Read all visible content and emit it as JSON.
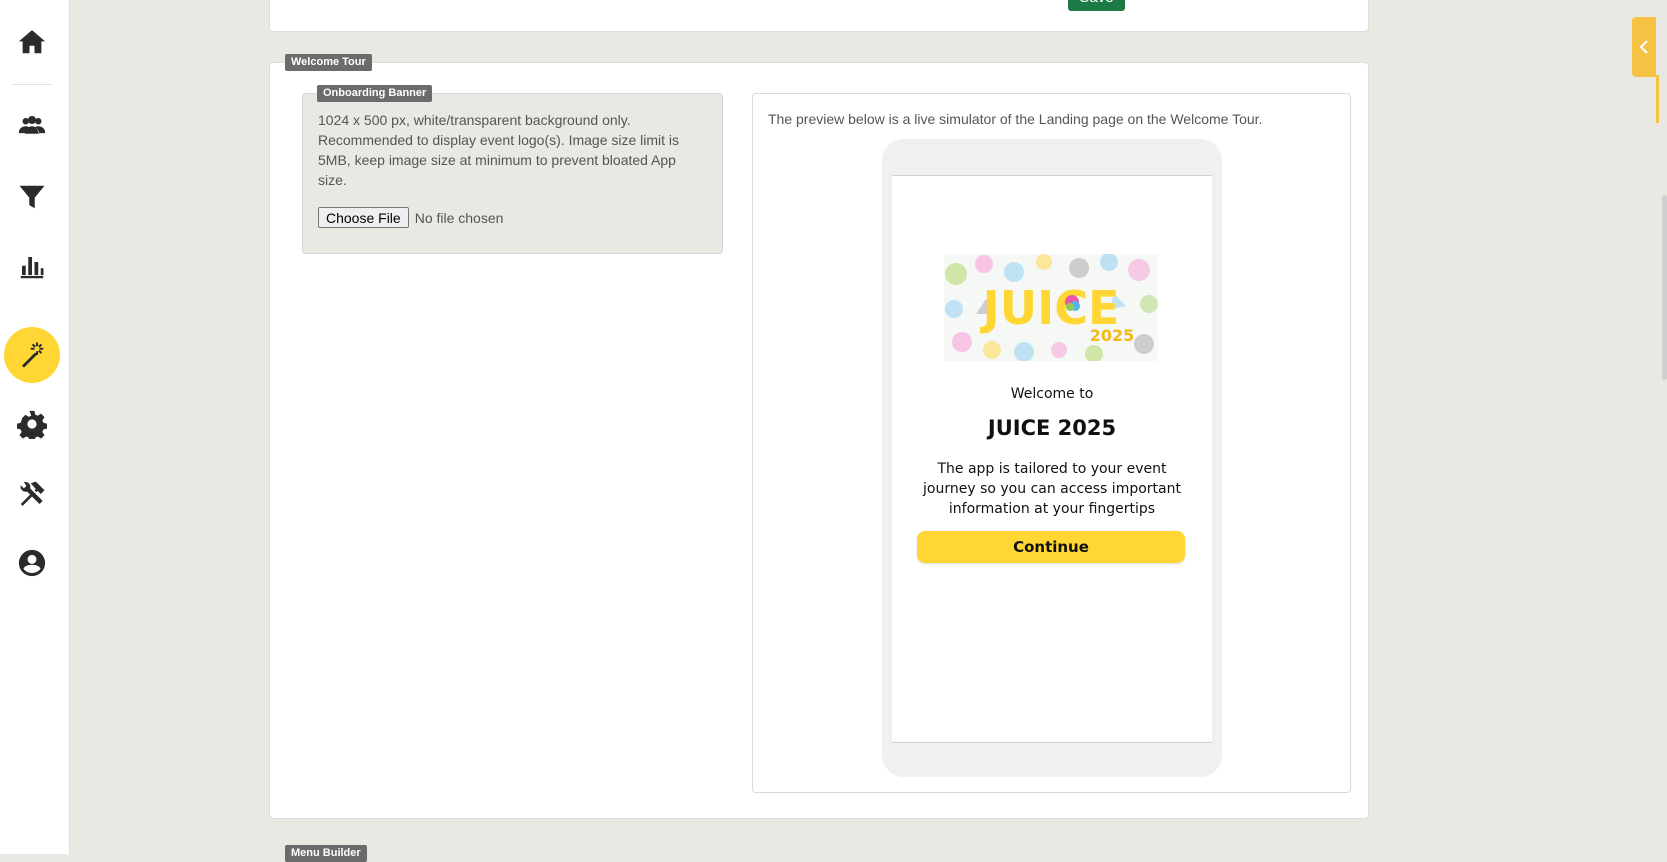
{
  "colors": {
    "accent": "#ffd634",
    "save": "#1e7a45",
    "tab": "#f6c244"
  },
  "sidebar": {
    "items": [
      {
        "name": "home-icon"
      },
      {
        "name": "users-icon"
      },
      {
        "name": "filter-icon"
      },
      {
        "name": "bar-chart-icon"
      },
      {
        "name": "magic-wand-icon",
        "active": true
      },
      {
        "name": "gear-icon"
      },
      {
        "name": "tools-icon"
      },
      {
        "name": "user-circle-icon"
      }
    ]
  },
  "top_card": {
    "save_label": "Save"
  },
  "welcome_tour": {
    "tag": "Welcome Tour",
    "banner": {
      "tag": "Onboarding Banner",
      "description": "1024 x 500 px, white/transparent background only. Recommended to display event logo(s). Image size limit is 5MB, keep image size at minimum to prevent bloated App size.",
      "choose_file_label": "Choose File",
      "file_status": "No file chosen"
    },
    "preview": {
      "description": "The preview below is a live simulator of the Landing page on the Welcome Tour.",
      "logo_text": "JUICE",
      "logo_year": "2025",
      "welcome_to": "Welcome to",
      "event_name": "JUICE 2025",
      "body": "The app is tailored to your event journey so you can access important information at your fingertips",
      "continue_label": "Continue"
    }
  },
  "next_section": {
    "tag": "Menu Builder"
  }
}
